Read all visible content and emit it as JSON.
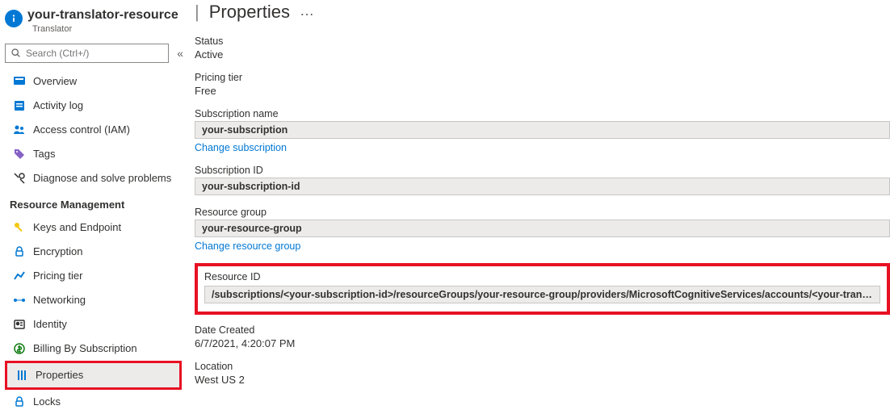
{
  "header": {
    "resource_name": "your-translator-resource",
    "resource_type": "Translator"
  },
  "search": {
    "placeholder": "Search (Ctrl+/)"
  },
  "nav": {
    "overview": "Overview",
    "activity_log": "Activity log",
    "access_control": "Access control (IAM)",
    "tags": "Tags",
    "diagnose": "Diagnose and solve problems",
    "section_rm": "Resource Management",
    "keys_endpoint": "Keys and Endpoint",
    "encryption": "Encryption",
    "pricing_tier": "Pricing tier",
    "networking": "Networking",
    "identity": "Identity",
    "billing_sub": "Billing By Subscription",
    "properties": "Properties",
    "locks": "Locks"
  },
  "page": {
    "title": "Properties",
    "ellipsis": "…"
  },
  "props": {
    "status_label": "Status",
    "status_value": "Active",
    "tier_label": "Pricing tier",
    "tier_value": "Free",
    "sub_name_label": "Subscription name",
    "sub_name_value": "your-subscription",
    "change_subscription": "Change subscription",
    "sub_id_label": "Subscription ID",
    "sub_id_value": "your-subscription-id",
    "rg_label": "Resource group",
    "rg_value": "your-resource-group",
    "change_rg": "Change resource group",
    "resource_id_label": "Resource ID",
    "resource_id_value": "/subscriptions/<your-subscription-id>/resourceGroups/your-resource-group/providers/MicrosoftCognitiveServices/accounts/<your-translator-resource>",
    "date_created_label": "Date Created",
    "date_created_value": "6/7/2021, 4:20:07 PM",
    "location_label": "Location",
    "location_value": "West US 2"
  }
}
